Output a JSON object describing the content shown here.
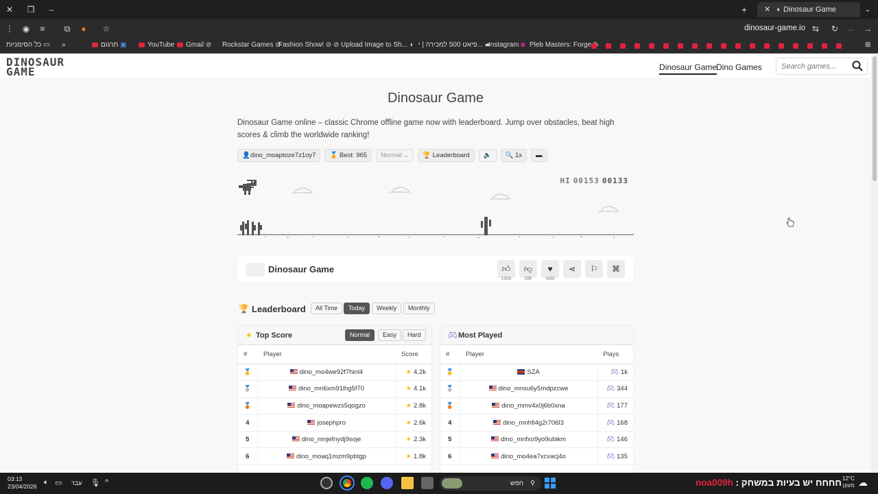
{
  "browser": {
    "tab_title": "Dinosaur Game",
    "url": "dinosaur-game.io",
    "bookmarks": [
      {
        "label": "כל הסימניות"
      },
      {
        "label": "»"
      },
      {
        "label": "תרגום"
      },
      {
        "label": "YouTube"
      },
      {
        "label": "Gmail"
      },
      {
        "label": "Rockstar Games"
      },
      {
        "label": "Fashion Show!"
      },
      {
        "label": "Upload Image to Sh..."
      },
      {
        "label": "פיאט 500 למכירה | י..."
      },
      {
        "label": "Instagram"
      },
      {
        "label": "Pleb Masters: Forge"
      }
    ]
  },
  "site": {
    "logo_line1": "DINOSAUR",
    "logo_line2": "GAME",
    "nav": [
      "Dinosaur Game",
      "Dino Games"
    ],
    "search_placeholder": "Search games..."
  },
  "page": {
    "title": "Dinosaur Game",
    "description": "Dinosaur Game online – classic Chrome offline game now with leaderboard. Jump over obstacles, beat high scores & climb the worldwide ranking!",
    "chips": {
      "user": "dino_moaptoze7z1oy7",
      "best": "Best: 965",
      "difficulty": "Normal",
      "leaderboard": "Leaderboard",
      "zoom": "1x"
    }
  },
  "game": {
    "hi_label": "HI",
    "hi_score": "00153",
    "current_score": "00133"
  },
  "game_bar": {
    "title": "Dinosaur Game",
    "likes": "190k",
    "dislikes": "28k",
    "fav_label": "Add"
  },
  "leaderboard": {
    "title": "Leaderboard",
    "periods": [
      "All Time",
      "Today",
      "Weekly",
      "Monthly"
    ],
    "active_period": "Today",
    "top_score": {
      "title": "Top Score",
      "modes": [
        "Normal",
        "Easy",
        "Hard"
      ],
      "columns": [
        "#",
        "Player",
        "Score"
      ],
      "rows": [
        {
          "rank": "",
          "player": "dino_mo4we92f7hinl4",
          "value": "4.2k"
        },
        {
          "rank": "",
          "player": "dino_mn6xm91lhg5f70",
          "value": "4.1k"
        },
        {
          "rank": "",
          "player": "dino_moapewzs5qogzo",
          "value": "2.8k"
        },
        {
          "rank": "4",
          "player": "josephpro",
          "value": "2.6k"
        },
        {
          "rank": "5",
          "player": "dino_mnjefnydj9soje",
          "value": "2.3k"
        },
        {
          "rank": "6",
          "player": "dino_moaq1mzm9pbtgp",
          "value": "1.8k"
        }
      ]
    },
    "most_played": {
      "title": "Most Played",
      "columns": [
        "#",
        "Player",
        "Plays"
      ],
      "rows": [
        {
          "rank": "",
          "player": "SZA",
          "value": "1k"
        },
        {
          "rank": "",
          "player": "dino_mnsu6y5mdpzcwe",
          "value": "344"
        },
        {
          "rank": "",
          "player": "dino_mmv4x0j6b0xna",
          "value": "177"
        },
        {
          "rank": "4",
          "player": "dino_mnhfi4g2r706l3",
          "value": "168"
        },
        {
          "rank": "5",
          "player": "dino_mnfxo9yo9ubikm",
          "value": "146"
        },
        {
          "rank": "6",
          "player": "dino_mo4ea7xcvacj4o",
          "value": "135"
        }
      ]
    }
  },
  "taskbar": {
    "time": "03:13",
    "date": "23/04/2026",
    "lang": "עבר",
    "search_text": "חפש",
    "ticker_text": "חחחח יש בעיות במשחק :",
    "ticker_name": "noa009h",
    "temp": "12°C",
    "weather_label": "מעונן"
  }
}
